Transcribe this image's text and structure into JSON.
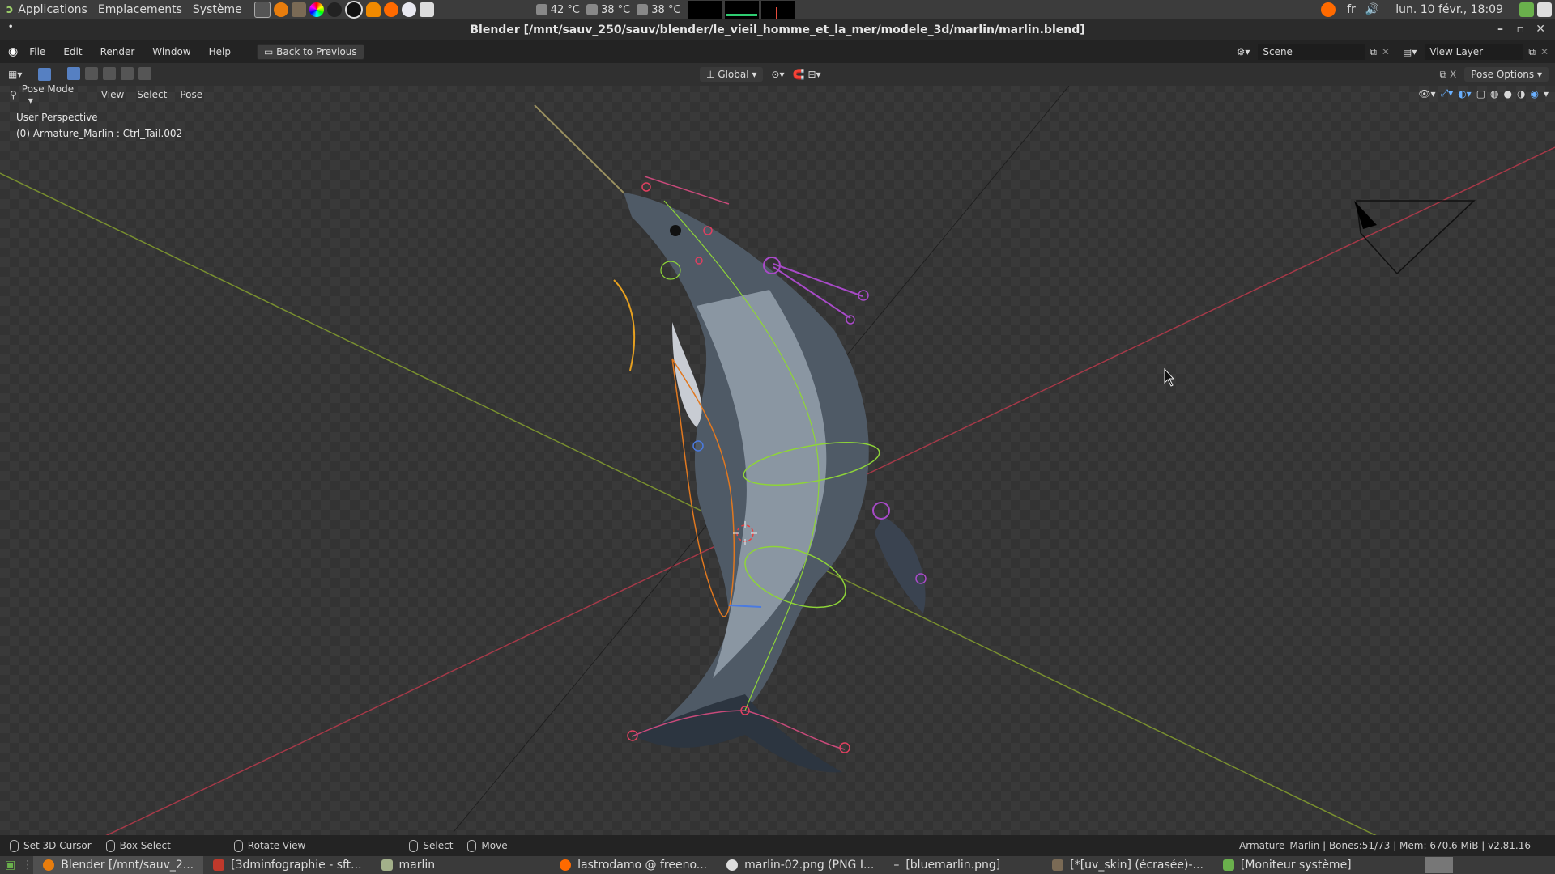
{
  "gnome_panel": {
    "menus": [
      "Applications",
      "Emplacements",
      "Système"
    ],
    "temps": [
      "42 °C",
      "38 °C",
      "38 °C"
    ],
    "lang": "fr",
    "datetime": "lun. 10 févr., 18:09"
  },
  "window": {
    "title": "Blender [/mnt/sauv_250/sauv/blender/le_vieil_homme_et_la_mer/modele_3d/marlin/marlin.blend]"
  },
  "menubar": {
    "items": [
      "File",
      "Edit",
      "Render",
      "Window",
      "Help"
    ],
    "back_button": "Back to Previous",
    "scene_label": "Scene",
    "view_layer_label": "View Layer"
  },
  "header": {
    "orientation": "Global",
    "pose_options": "Pose Options",
    "mode": "Pose Mode",
    "menus": [
      "View",
      "Select",
      "Pose"
    ]
  },
  "viewport": {
    "perspective": "User Perspective",
    "active_bone": "(0) Armature_Marlin : Ctrl_Tail.002"
  },
  "statusbar": {
    "items": [
      "Set 3D Cursor",
      "Box Select",
      "Rotate View",
      "Select",
      "Move"
    ],
    "info": "Armature_Marlin | Bones:51/73 | Mem: 670.6 MiB | v2.81.16"
  },
  "taskbar": {
    "tasks": [
      "Blender [/mnt/sauv_2...",
      "[3dminfographie - sft...",
      "marlin",
      "lastrodamo @ freeno...",
      "marlin-02.png (PNG I...",
      "[bluemarlin.png]",
      "[*[uv_skin] (écrasée)-...",
      "[Moniteur système]"
    ]
  }
}
